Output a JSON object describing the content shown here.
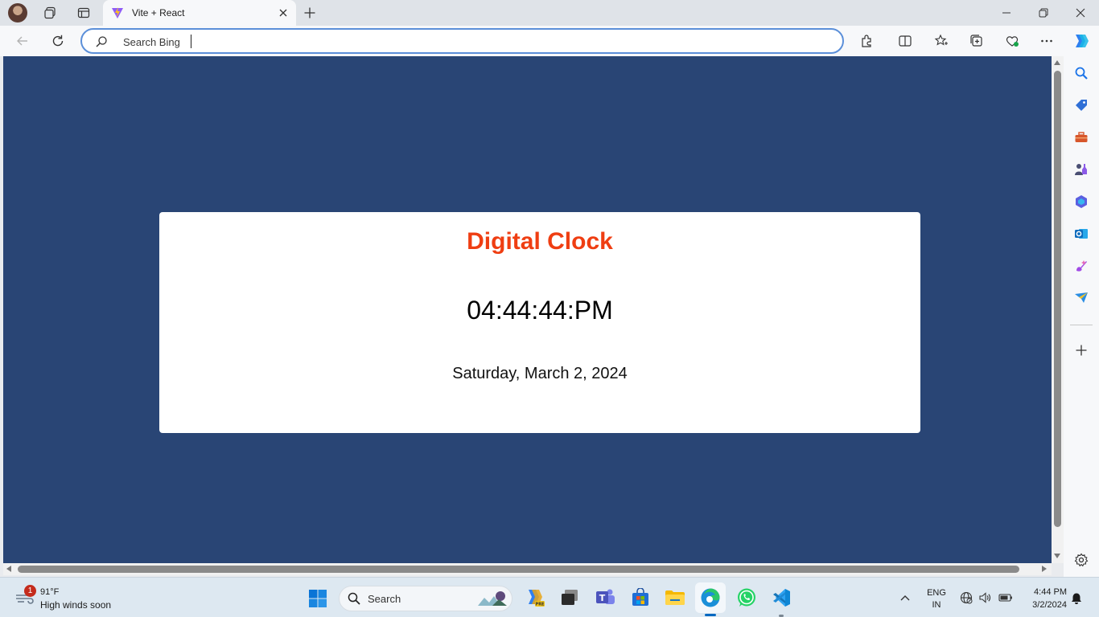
{
  "browser": {
    "tab": {
      "title": "Vite + React"
    },
    "address_bar": {
      "placeholder": "Search Bing",
      "value": ""
    }
  },
  "page": {
    "title": "Digital Clock",
    "time": "04:44:44:PM",
    "date": "Saturday, March 2, 2024",
    "background_color": "#294575",
    "title_color": "#ef3e12"
  },
  "sidebar": {
    "icons": [
      "search-icon",
      "shopping-tag-icon",
      "toolbox-icon",
      "games-icon",
      "microsoft365-icon",
      "outlook-icon",
      "designer-icon",
      "send-icon",
      "add-icon",
      "settings-icon"
    ]
  },
  "taskbar": {
    "weather": {
      "badge": "1",
      "temp": "91°F",
      "desc": "High winds soon"
    },
    "search_label": "Search",
    "language": {
      "line1": "ENG",
      "line2": "IN"
    },
    "clock": {
      "time": "4:44 PM",
      "date": "3/2/2024"
    }
  }
}
